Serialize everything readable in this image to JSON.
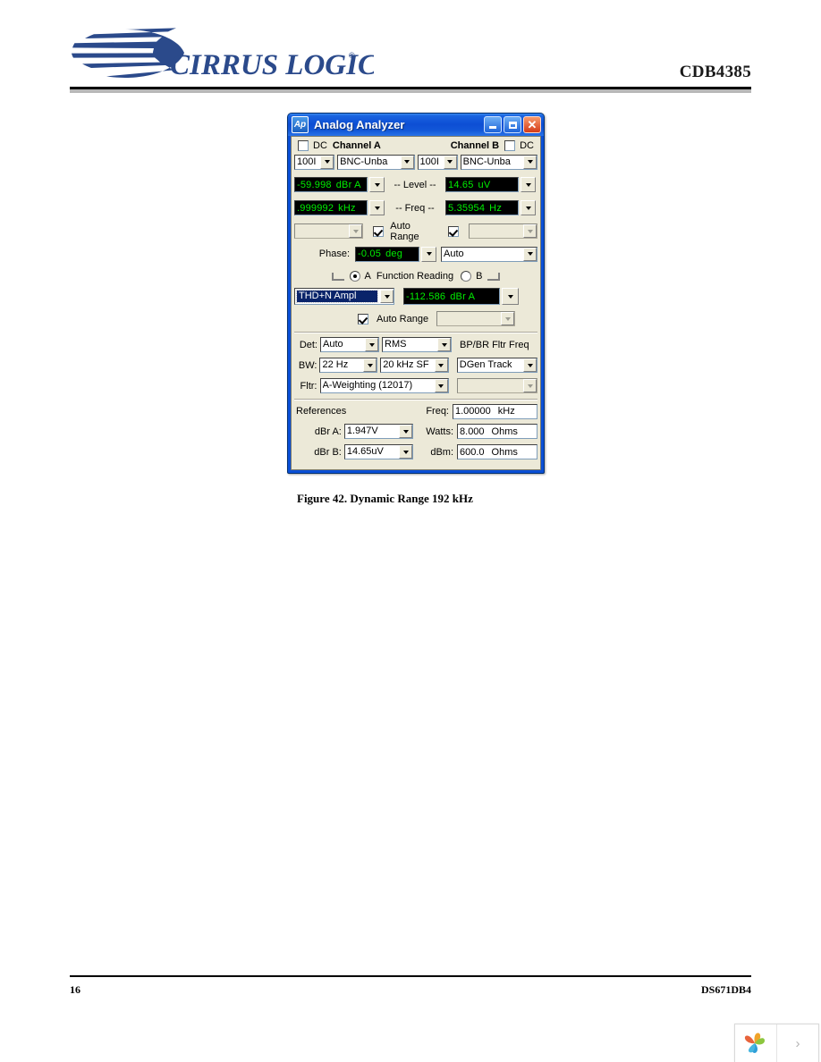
{
  "header": {
    "brand": "CIRRUS LOGIC",
    "brand_mark": "®",
    "doc_code": "CDB4385"
  },
  "figure": {
    "caption": "Figure 42.  Dynamic Range 192 kHz"
  },
  "footer": {
    "page_number": "16",
    "doc_id": "DS671DB4"
  },
  "corner_widget": {
    "arrow": "›"
  },
  "dialog": {
    "app_icon_text": "Ap",
    "title": "Analog Analyzer",
    "buttons": {
      "minimize": "minimize",
      "maximize": "maximize",
      "close": "close"
    },
    "channels": {
      "dc_left_label": "DC",
      "channel_a_label": "Channel A",
      "channel_b_label": "Channel B",
      "dc_right_label": "DC",
      "a_impedance": "100I",
      "a_input": "BNC-Unba",
      "b_impedance": "100I",
      "b_input": "BNC-Unba"
    },
    "level": {
      "label": "-- Level --",
      "a_value": "-59.998",
      "a_unit": "dBr A",
      "b_value": "14.65",
      "b_unit": "uV"
    },
    "freq": {
      "label": "-- Freq --",
      "a_value": ".999992",
      "a_unit": "kHz",
      "b_value": "5.35954",
      "b_unit": "Hz"
    },
    "range_row": {
      "auto_range_label": "Auto Range",
      "left_range": "",
      "right_range": "",
      "left_checked": true,
      "right_checked": true
    },
    "phase": {
      "label": "Phase:",
      "value": "-0.05",
      "unit": "deg",
      "mode": "Auto"
    },
    "function": {
      "a_label": "A",
      "title": "Function Reading",
      "b_label": "B",
      "selected_channel": "A",
      "function_name": "THD+N Ampl",
      "reading_value": "-112.586",
      "reading_unit": "dBr A",
      "auto_range_label": "Auto Range",
      "auto_range_checked": true,
      "range_value": ""
    },
    "detector": {
      "det_label": "Det:",
      "det_mode": "Auto",
      "det_type": "RMS",
      "bw_label": "BW:",
      "bw_low": "22 Hz",
      "bw_high": "20 kHz SF",
      "fltr_label": "Fltr:",
      "fltr_value": "A-Weighting  (12017)",
      "bpbr_title": "BP/BR Fltr Freq",
      "bpbr_source": "DGen Track",
      "bpbr_value": ""
    },
    "references": {
      "title": "References",
      "freq_label": "Freq:",
      "freq_value": "1.00000",
      "freq_unit": "kHz",
      "dbra_label": "dBr A:",
      "dbra_value": "1.947",
      "dbra_unit": "V",
      "watts_label": "Watts:",
      "watts_value": "8.000",
      "watts_unit": "Ohms",
      "dbrb_label": "dBr B:",
      "dbrb_value": "14.65",
      "dbrb_unit": "uV",
      "dbm_label": "dBm:",
      "dbm_value": "600.0",
      "dbm_unit": "Ohms"
    }
  },
  "colors": {
    "title_blue": "#0a4fd6",
    "led_green": "#00ee00",
    "led_bg": "#000000",
    "dialog_face": "#ece9d8",
    "brand_blue": "#2b4a8b",
    "select_blue": "#0a246a"
  }
}
